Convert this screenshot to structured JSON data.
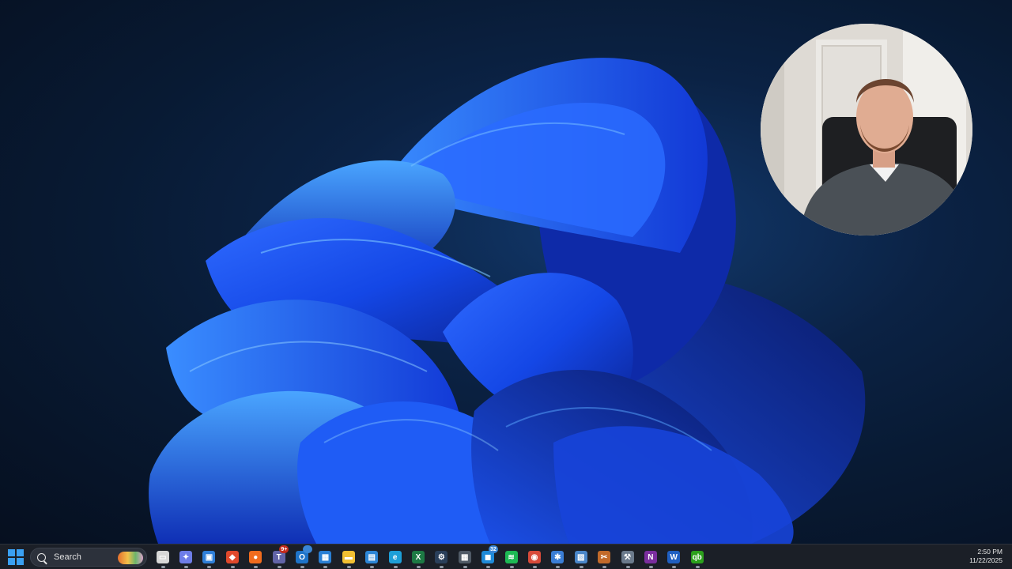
{
  "taskbar": {
    "search_label": "Search",
    "icons": [
      {
        "name": "task-view-icon",
        "color": "#d7d7d7",
        "glyph": "▭"
      },
      {
        "name": "copilot-icon",
        "color": "#6e7de8",
        "glyph": "✦"
      },
      {
        "name": "widgets-icon",
        "color": "#2f7fd8",
        "glyph": "▣"
      },
      {
        "name": "brave-browser-icon",
        "color": "#e0492c",
        "glyph": "◆"
      },
      {
        "name": "firefox-icon",
        "color": "#f26c1d",
        "glyph": "●"
      },
      {
        "name": "teams-icon",
        "color": "#6264a7",
        "glyph": "T",
        "badge": "9+",
        "badge_color": "#c42b1c"
      },
      {
        "name": "outlook-icon",
        "color": "#1e73c8",
        "glyph": "O",
        "badge": "",
        "badge_color": "#3a86d6"
      },
      {
        "name": "calendar-app-icon",
        "color": "#2a7fd4",
        "glyph": "▦"
      },
      {
        "name": "file-explorer-icon",
        "color": "#f2c033",
        "glyph": "▬"
      },
      {
        "name": "remote-desktop-icon",
        "color": "#2d86d6",
        "glyph": "▤"
      },
      {
        "name": "edge-icon",
        "color": "#1d9fd8",
        "glyph": "e"
      },
      {
        "name": "excel-icon",
        "color": "#1d7a44",
        "glyph": "X"
      },
      {
        "name": "steam-icon",
        "color": "#2a3f5a",
        "glyph": "⚙"
      },
      {
        "name": "calculator-icon",
        "color": "#505a66",
        "glyph": "▦"
      },
      {
        "name": "messages-icon",
        "color": "#1e8ad8",
        "glyph": "◼",
        "badge": "32",
        "badge_color": "#3a86d6"
      },
      {
        "name": "spotify-icon",
        "color": "#1db954",
        "glyph": "≋"
      },
      {
        "name": "chrome-icon",
        "color": "#d84a3a",
        "glyph": "◉"
      },
      {
        "name": "settings-icon",
        "color": "#3b7ed6",
        "glyph": "✱"
      },
      {
        "name": "paint-icon",
        "color": "#4a86c9",
        "glyph": "▧"
      },
      {
        "name": "snipping-tool-icon",
        "color": "#c26a2a",
        "glyph": "✂"
      },
      {
        "name": "network-tool-icon",
        "color": "#6b7a8c",
        "glyph": "⚒"
      },
      {
        "name": "onenote-icon",
        "color": "#7a2e9e",
        "glyph": "N"
      },
      {
        "name": "word-icon",
        "color": "#1f5fc1",
        "glyph": "W"
      },
      {
        "name": "quickbooks-icon",
        "color": "#2ca01c",
        "glyph": "qb"
      }
    ],
    "time": "2:50 PM",
    "date": "11/22/2025"
  }
}
